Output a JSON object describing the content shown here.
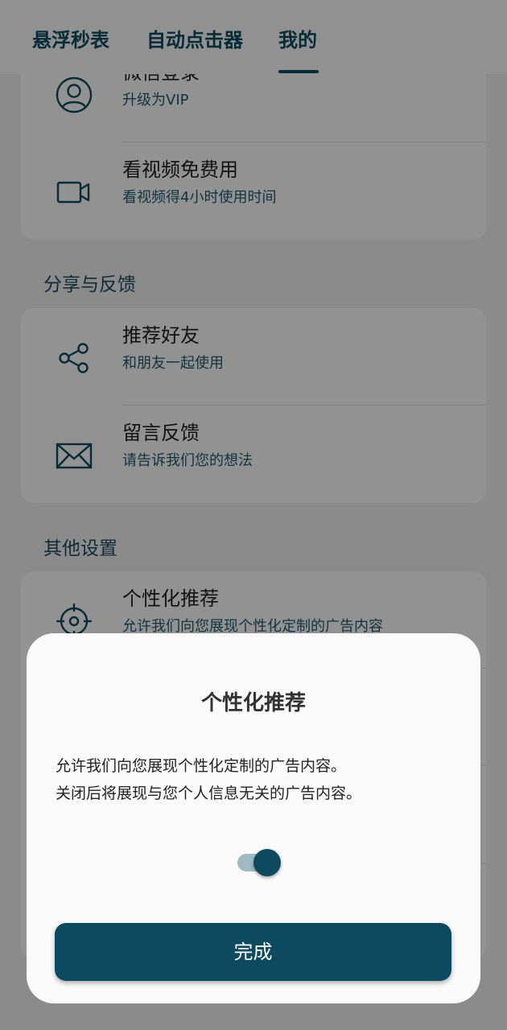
{
  "tabs": [
    {
      "label": "悬浮秒表"
    },
    {
      "label": "自动点击器"
    },
    {
      "label": "我的"
    }
  ],
  "account_card": {
    "items": [
      {
        "title": "微信登录",
        "subtitle": "升级为VIP",
        "icon": "user-circle-icon"
      },
      {
        "title": "看视频免费用",
        "subtitle": "看视频得4小时使用时间",
        "icon": "video-camera-icon"
      }
    ]
  },
  "share_section": {
    "title": "分享与反馈",
    "items": [
      {
        "title": "推荐好友",
        "subtitle": "和朋友一起使用",
        "icon": "share-icon"
      },
      {
        "title": "留言反馈",
        "subtitle": "请告诉我们您的想法",
        "icon": "mail-icon"
      }
    ]
  },
  "other_section": {
    "title": "其他设置",
    "items": [
      {
        "title": "个性化推荐",
        "subtitle": "允许我们向您展现个性化定制的广告内容",
        "icon": "target-icon"
      }
    ]
  },
  "dialog": {
    "title": "个性化推荐",
    "line1": "允许我们向您展现个性化定制的广告内容。",
    "line2": "关闭后将展现与您个人信息无关的广告内容。",
    "toggle_on": true,
    "done_label": "完成"
  },
  "colors": {
    "accent": "#0d4a5f",
    "subtitle": "#1f5a6e"
  }
}
